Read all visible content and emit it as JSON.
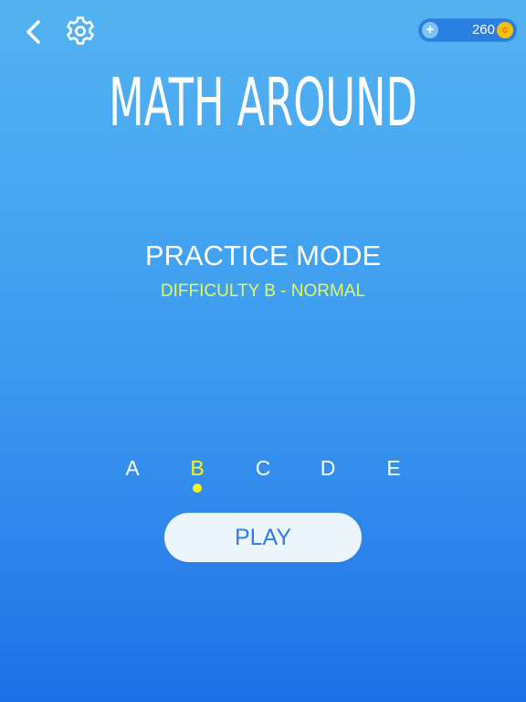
{
  "header": {
    "back_icon": "chevron-left-icon",
    "settings_icon": "gear-icon",
    "coins": {
      "add_label": "+",
      "amount": "260",
      "coin_symbol": "¢",
      "coin_color": "#f2c10f"
    }
  },
  "title": "MATH AROUND",
  "mode": {
    "title": "PRACTICE MODE",
    "difficulty": "DIFFICULTY B - NORMAL"
  },
  "levels": {
    "items": [
      "A",
      "B",
      "C",
      "D",
      "E"
    ],
    "selected": "B",
    "selected_color": "#f4f41a"
  },
  "play_label": "PLAY",
  "colors": {
    "background_top": "#53b3f1",
    "background_bottom": "#1e6fe6",
    "accent_yellow": "#e7f75a",
    "play_text": "#2e7fe1"
  }
}
